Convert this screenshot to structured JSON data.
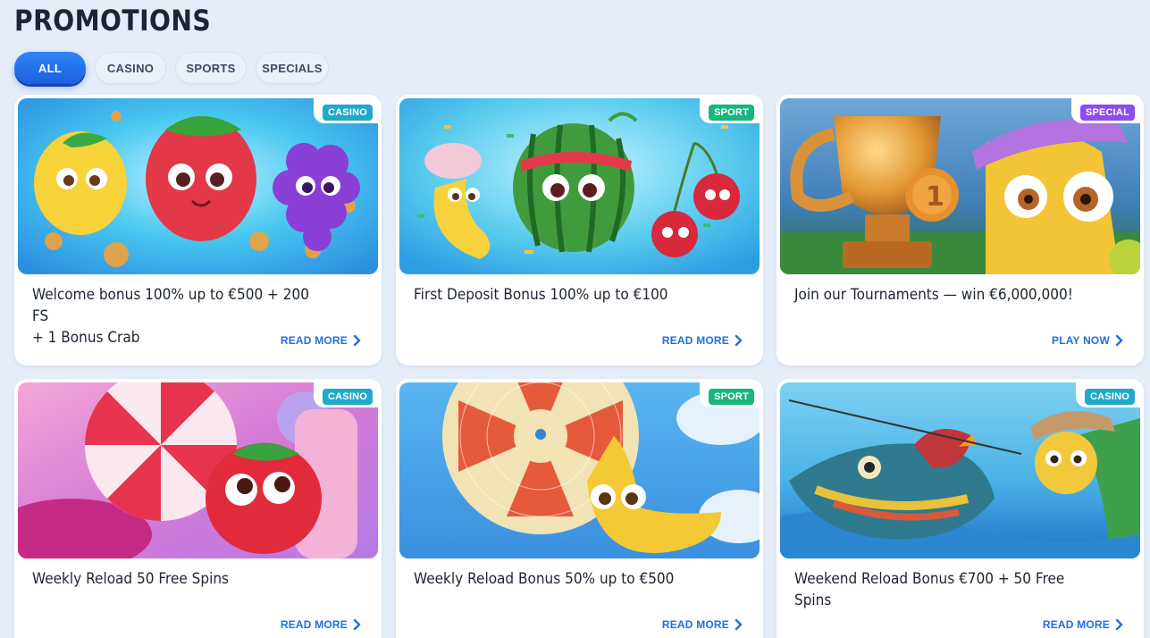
{
  "page": {
    "title": "PROMOTIONS"
  },
  "filters": [
    {
      "label": "ALL",
      "active": true
    },
    {
      "label": "CASINO",
      "active": false
    },
    {
      "label": "SPORTS",
      "active": false
    },
    {
      "label": "SPECIALS",
      "active": false
    }
  ],
  "cards": [
    {
      "badge": "CASINO",
      "title_line1": "Welcome bonus 100% up to €500 + 200 FS",
      "title_line2": "+ 1 Bonus Crab",
      "cta": "READ MORE",
      "art": "fruits-coins"
    },
    {
      "badge": "SPORT",
      "title_line1": "First Deposit Bonus 100% up to €100",
      "title_line2": "",
      "cta": "READ MORE",
      "art": "watermelon-banana"
    },
    {
      "badge": "SPECIAL",
      "title_line1": "Join our Tournaments — win €6,000,000!",
      "title_line2": "",
      "cta": "PLAY NOW",
      "art": "trophy"
    },
    {
      "badge": "CASINO",
      "title_line1": "Weekly Reload 50 Free Spins",
      "title_line2": "",
      "cta": "READ MORE",
      "art": "candy-strawberry"
    },
    {
      "badge": "SPORT",
      "title_line1": "Weekly Reload Bonus 50% up to €500",
      "title_line2": "",
      "cta": "READ MORE",
      "art": "parachute-banana"
    },
    {
      "badge": "CASINO",
      "title_line1": "Weekend Reload Bonus €700 + 50 Free Spins",
      "title_line2": "",
      "cta": "READ MORE",
      "art": "fishing"
    }
  ],
  "colors": {
    "accent": "#1f6fe0",
    "casino_badge": "#20a9c9",
    "sport_badge": "#17b67d",
    "special_badge": "#8b4cf0"
  }
}
